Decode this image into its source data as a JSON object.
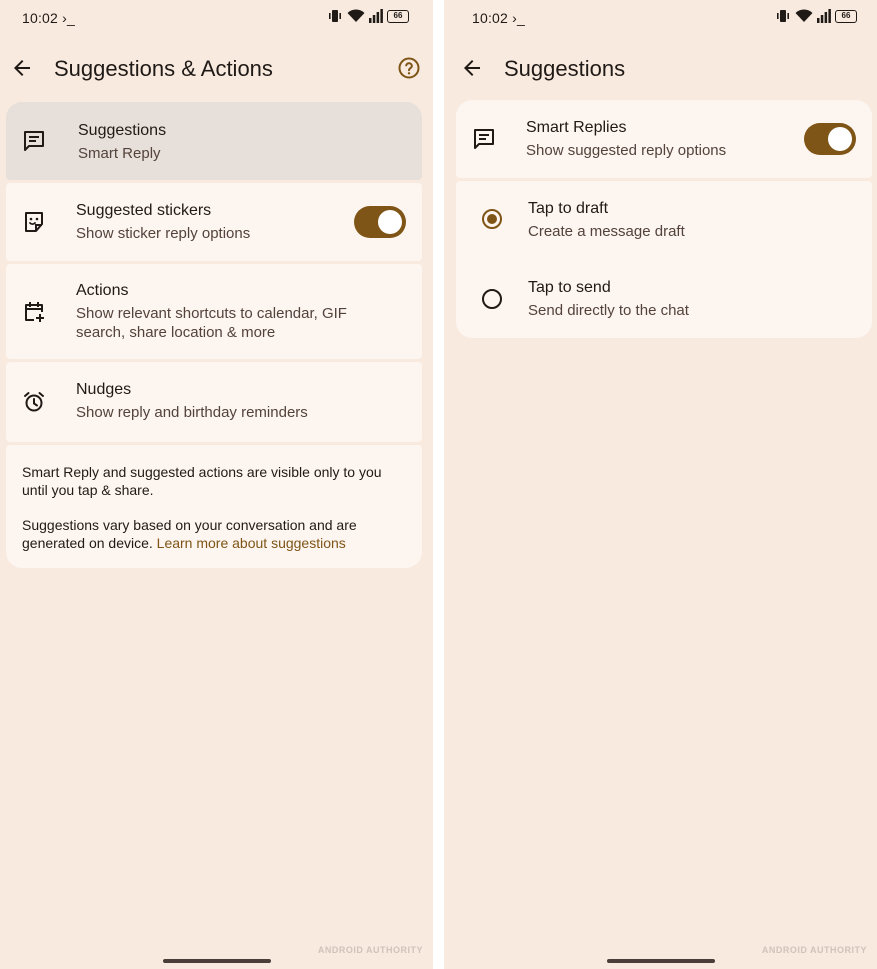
{
  "status": {
    "time": "10:02",
    "prompt_glyph": "›_",
    "battery": "66"
  },
  "left": {
    "title": "Suggestions & Actions",
    "items": [
      {
        "title": "Suggestions",
        "subtitle": "Smart Reply"
      },
      {
        "title": "Suggested stickers",
        "subtitle": "Show sticker reply options",
        "toggle": "on"
      },
      {
        "title": "Actions",
        "subtitle": "Show relevant shortcuts to calendar, GIF search, share location & more"
      },
      {
        "title": "Nudges",
        "subtitle": "Show reply and birthday reminders"
      }
    ],
    "footer": {
      "p1": "Smart Reply and suggested actions are visible only to you until you tap & share.",
      "p2_text": "Suggestions vary based on your conversation and are generated on device. ",
      "p2_link": "Learn more about suggestions"
    },
    "watermark": "ANDROID AUTHORITY"
  },
  "right": {
    "title": "Suggestions",
    "smart_replies": {
      "title": "Smart Replies",
      "subtitle": "Show suggested reply options",
      "toggle": "on"
    },
    "options": [
      {
        "title": "Tap to draft",
        "subtitle": "Create a message draft",
        "selected": true
      },
      {
        "title": "Tap to send",
        "subtitle": "Send directly to the chat",
        "selected": false
      }
    ],
    "watermark": "ANDROID AUTHORITY"
  },
  "colors": {
    "background": "#f8eadf",
    "card": "#fdf5ef",
    "accent": "#7e5517",
    "text": "#201a17",
    "secondary_text": "#53433c"
  },
  "icons": [
    "back-arrow-icon",
    "help-icon",
    "message-icon",
    "sticker-icon",
    "calendar-add-icon",
    "alarm-icon",
    "vibrate-icon",
    "wifi-icon",
    "signal-icon",
    "battery-icon"
  ]
}
